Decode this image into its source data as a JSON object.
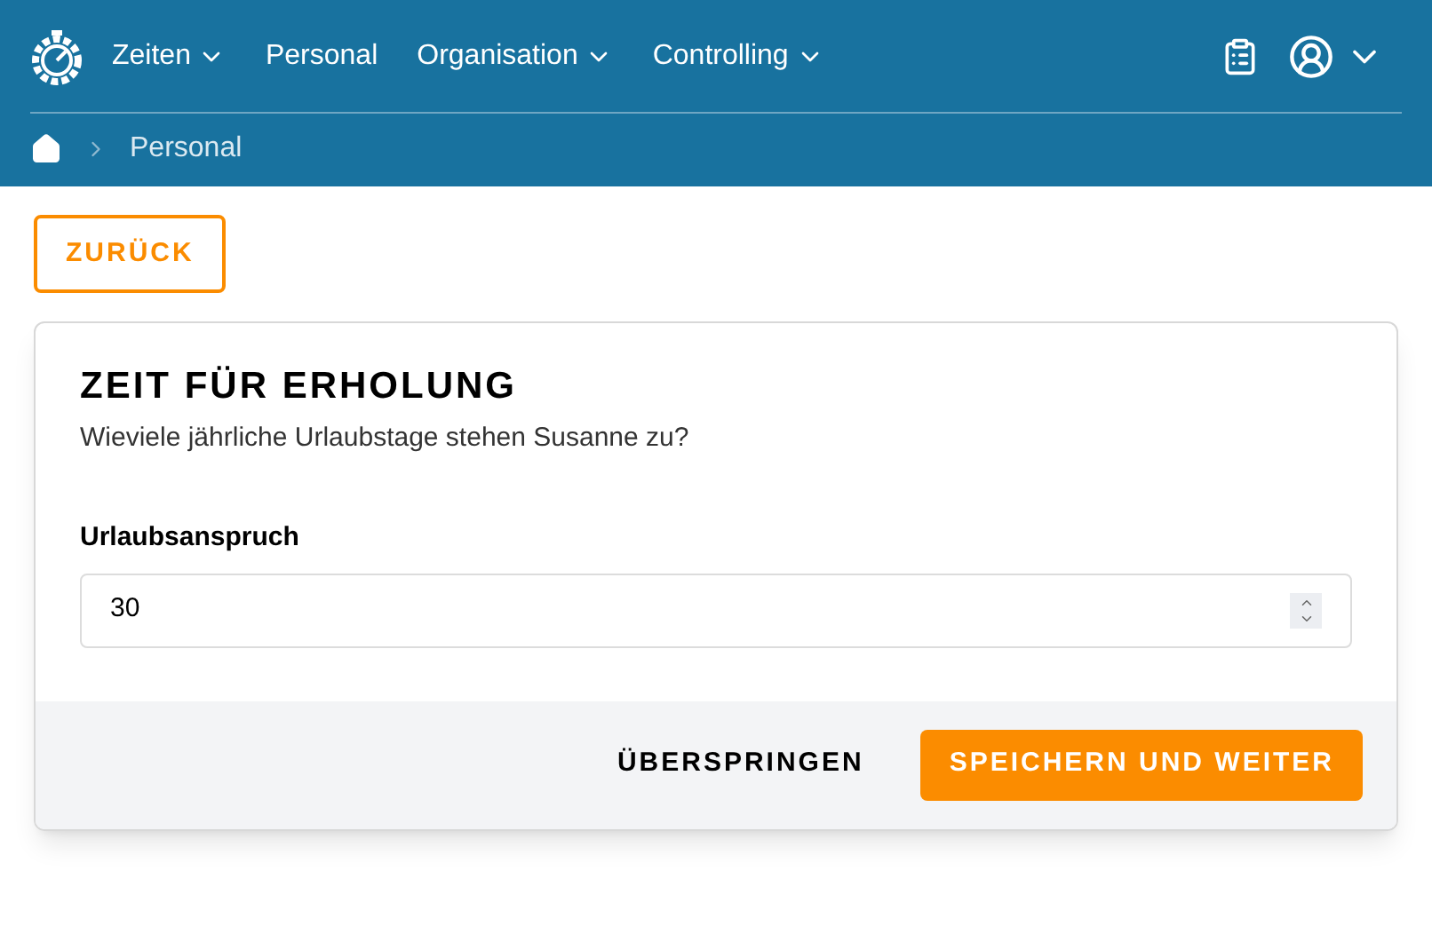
{
  "nav": {
    "items": [
      {
        "label": "Zeiten",
        "dropdown": true
      },
      {
        "label": "Personal",
        "dropdown": false
      },
      {
        "label": "Organisation",
        "dropdown": true
      },
      {
        "label": "Controlling",
        "dropdown": true
      }
    ]
  },
  "breadcrumb": [
    "Personal"
  ],
  "back_button": "ZURÜCK",
  "card": {
    "title": "ZEIT FÜR ERHOLUNG",
    "subtitle": "Wieviele jährliche Urlaubstage stehen Susanne zu?",
    "field": {
      "label": "Urlaubsanspruch",
      "value": "30"
    },
    "skip_button": "ÜBERSPRINGEN",
    "save_button": "SPEICHERN UND WEITER"
  }
}
